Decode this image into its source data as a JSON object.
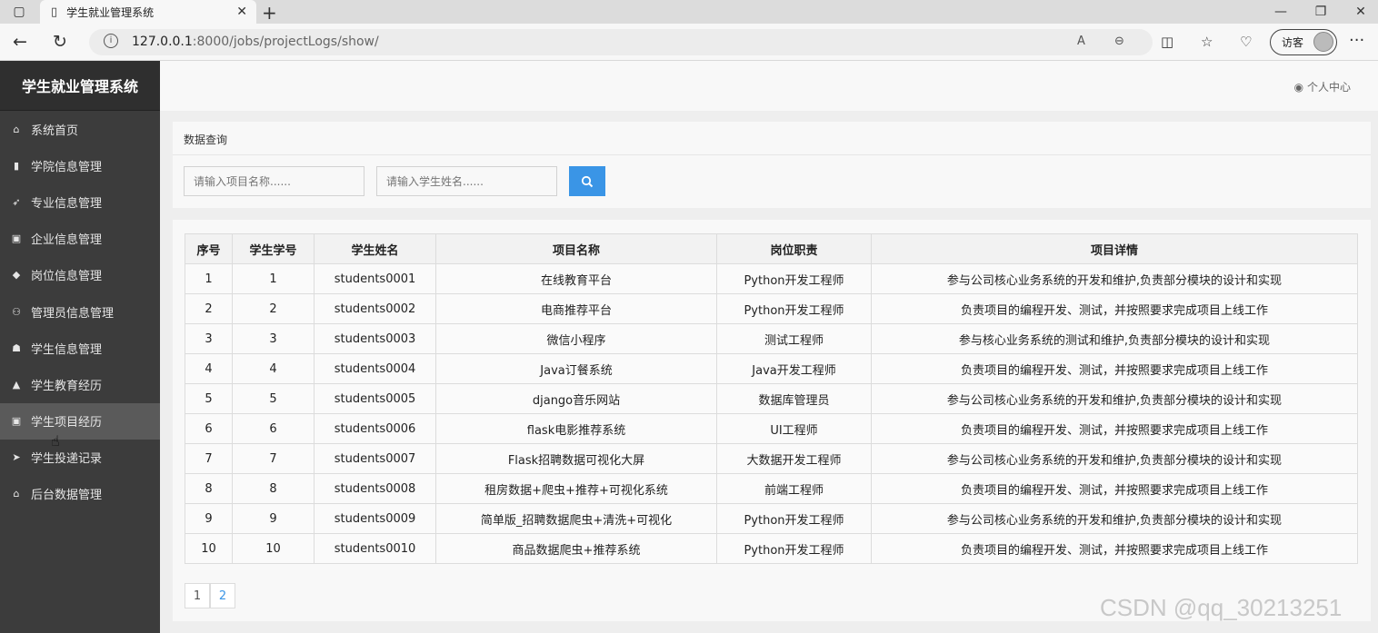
{
  "browser": {
    "tab_title": "学生就业管理系统",
    "url_host": "127.0.0.1",
    "url_rest": ":8000/jobs/projectLogs/show/",
    "profile_label": "访客"
  },
  "sidebar": {
    "brand": "学生就业管理系统",
    "items": [
      {
        "label": "系统首页",
        "icon": "home-icon",
        "glyph": "⌂"
      },
      {
        "label": "学院信息管理",
        "icon": "book-icon",
        "glyph": "▮"
      },
      {
        "label": "专业信息管理",
        "icon": "rocket-icon",
        "glyph": "➶"
      },
      {
        "label": "企业信息管理",
        "icon": "id-card-icon",
        "glyph": "▣"
      },
      {
        "label": "岗位信息管理",
        "icon": "diamond-icon",
        "glyph": "◆"
      },
      {
        "label": "管理员信息管理",
        "icon": "user-icon",
        "glyph": "⚇"
      },
      {
        "label": "学生信息管理",
        "icon": "users-icon",
        "glyph": "☗"
      },
      {
        "label": "学生教育经历",
        "icon": "graduation-cap-icon",
        "glyph": "▲"
      },
      {
        "label": "学生项目经历",
        "icon": "id-card-icon",
        "glyph": "▣"
      },
      {
        "label": "学生投递记录",
        "icon": "send-icon",
        "glyph": "➤"
      },
      {
        "label": "后台数据管理",
        "icon": "home-icon",
        "glyph": "⌂"
      }
    ],
    "active_index": 8
  },
  "header": {
    "personal_center": "个人中心"
  },
  "query": {
    "title": "数据查询",
    "project_placeholder": "请输入项目名称......",
    "student_placeholder": "请输入学生姓名......"
  },
  "table": {
    "headers": [
      "序号",
      "学生学号",
      "学生姓名",
      "项目名称",
      "岗位职责",
      "项目详情"
    ],
    "rows": [
      [
        "1",
        "1",
        "students0001",
        "在线教育平台",
        "Python开发工程师",
        "参与公司核心业务系统的开发和维护,负责部分模块的设计和实现"
      ],
      [
        "2",
        "2",
        "students0002",
        "电商推荐平台",
        "Python开发工程师",
        "负责项目的编程开发、测试，并按照要求完成项目上线工作"
      ],
      [
        "3",
        "3",
        "students0003",
        "微信小程序",
        "测试工程师",
        "参与核心业务系统的测试和维护,负责部分模块的设计和实现"
      ],
      [
        "4",
        "4",
        "students0004",
        "Java订餐系统",
        "Java开发工程师",
        "负责项目的编程开发、测试，并按照要求完成项目上线工作"
      ],
      [
        "5",
        "5",
        "students0005",
        "django音乐网站",
        "数据库管理员",
        "参与公司核心业务系统的开发和维护,负责部分模块的设计和实现"
      ],
      [
        "6",
        "6",
        "students0006",
        "flask电影推荐系统",
        "UI工程师",
        "负责项目的编程开发、测试，并按照要求完成项目上线工作"
      ],
      [
        "7",
        "7",
        "students0007",
        "Flask招聘数据可视化大屏",
        "大数据开发工程师",
        "参与公司核心业务系统的开发和维护,负责部分模块的设计和实现"
      ],
      [
        "8",
        "8",
        "students0008",
        "租房数据+爬虫+推荐+可视化系统",
        "前端工程师",
        "负责项目的编程开发、测试，并按照要求完成项目上线工作"
      ],
      [
        "9",
        "9",
        "students0009",
        "简单版_招聘数据爬虫+清洗+可视化",
        "Python开发工程师",
        "参与公司核心业务系统的开发和维护,负责部分模块的设计和实现"
      ],
      [
        "10",
        "10",
        "students0010",
        "商品数据爬虫+推荐系统",
        "Python开发工程师",
        "负责项目的编程开发、测试，并按照要求完成项目上线工作"
      ]
    ]
  },
  "pagination": {
    "pages": [
      "1",
      "2"
    ],
    "current": "2"
  },
  "watermark": "CSDN @qq_30213251",
  "colors": {
    "sidebar_bg": "#3c3c3c",
    "accent_blue": "#3a95e6"
  }
}
